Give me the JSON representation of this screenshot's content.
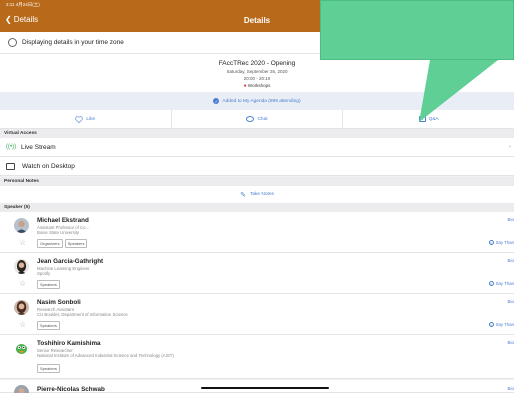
{
  "status": {
    "time": "2:11",
    "date": "4月24日(土)"
  },
  "nav": {
    "back_label": "Details",
    "title": "Details"
  },
  "timezone": {
    "text": "Displaying details in your time zone"
  },
  "event": {
    "title": "FAccTRec 2020 - Opening",
    "date": "Saturday, September 26, 2020",
    "time": "20:00 - 20:10",
    "tag": "Workshops"
  },
  "agenda": {
    "text": "Added to My Agenda (899 attending)"
  },
  "actions": {
    "like": "Like",
    "chat": "Chat",
    "qa": "Q&A"
  },
  "virtual_access": {
    "header": "Virtual Access",
    "live_stream": "Live Stream",
    "watch_desktop": "Watch on Desktop"
  },
  "personal_notes": {
    "header": "Personal Notes",
    "take_notes": "Take Notes"
  },
  "speakers_header": "Speaker (5)",
  "speakers": [
    {
      "name": "Michael Ekstrand",
      "role": "Assistant Professor of Co...",
      "org": "Boise State University",
      "tags": [
        "Organizers",
        "Speakers"
      ],
      "bio": "Bio",
      "say": "Say Than"
    },
    {
      "name": "Jean Garcia-Gathright",
      "role": "Machine Learning Engineer",
      "org": "Spotify",
      "tags": [
        "Speakers"
      ],
      "bio": "Bio",
      "say": "Say Than"
    },
    {
      "name": "Nasim Sonboli",
      "role": "Research Assistant",
      "org": "CU Boulder, Department of Information Science",
      "tags": [
        "Speakers"
      ],
      "bio": "Bio",
      "say": "Say Than"
    },
    {
      "name": "Toshihiro Kamishima",
      "role": "Senior Researcher",
      "org": "National Institute of Advanced Industrial Science and Technology (AIST)",
      "tags": [
        "Speakers"
      ],
      "bio": "Bio",
      "say": ""
    },
    {
      "name": "Pierre-Nicolas Schwab",
      "role": "",
      "org": "",
      "tags": [],
      "bio": "Bio",
      "say": ""
    }
  ],
  "colors": {
    "brand": "#b86a1a",
    "accent": "#4a7fd0",
    "callout": "#5fcf96"
  }
}
